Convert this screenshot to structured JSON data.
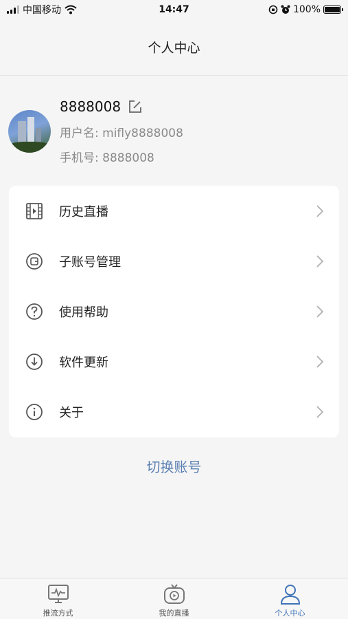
{
  "status_bar": {
    "carrier": "中国移动",
    "time": "14:47",
    "battery": "100%"
  },
  "nav": {
    "title": "个人中心"
  },
  "profile": {
    "display_name": "8888008",
    "username_line": "用户名: mifly8888008",
    "phone_line": "手机号: 8888008"
  },
  "menu": {
    "items": [
      {
        "label": "历史直播",
        "icon": "film-icon"
      },
      {
        "label": "子账号管理",
        "icon": "wallet-icon"
      },
      {
        "label": "使用帮助",
        "icon": "help-icon"
      },
      {
        "label": "软件更新",
        "icon": "download-icon"
      },
      {
        "label": "关于",
        "icon": "info-icon"
      }
    ]
  },
  "switch_account": "切换账号",
  "tabs": [
    {
      "label": "推流方式",
      "icon": "monitor-icon",
      "active": false
    },
    {
      "label": "我的直播",
      "icon": "tv-play-icon",
      "active": false
    },
    {
      "label": "个人中心",
      "icon": "person-icon",
      "active": true
    }
  ],
  "colors": {
    "accent": "#3f73b8",
    "link": "#5b7fb3",
    "background": "#f5f5f5"
  }
}
